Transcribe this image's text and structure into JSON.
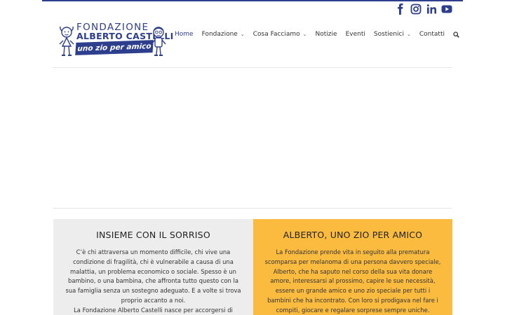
{
  "brand": {
    "line1": "FONDAZIONE",
    "line2": "ALBERTO CASTELLI",
    "tagline": "uno zio per amico",
    "color": "#2d3e8c"
  },
  "social": [
    {
      "icon": "facebook-icon"
    },
    {
      "icon": "instagram-icon"
    },
    {
      "icon": "linkedin-icon"
    },
    {
      "icon": "youtube-icon"
    }
  ],
  "nav": {
    "items": [
      {
        "label": "Home",
        "active": true,
        "dropdown": false
      },
      {
        "label": "Fondazione",
        "active": false,
        "dropdown": true
      },
      {
        "label": "Cosa Facciamo",
        "active": false,
        "dropdown": true
      },
      {
        "label": "Notizie",
        "active": false,
        "dropdown": false
      },
      {
        "label": "Eventi",
        "active": false,
        "dropdown": false
      },
      {
        "label": "Sostienici",
        "active": false,
        "dropdown": true
      },
      {
        "label": "Contatti",
        "active": false,
        "dropdown": false
      }
    ],
    "search_icon": "search-icon"
  },
  "panels": {
    "left": {
      "title": "INSIEME CON IL SORRISO",
      "text1": "C’è chi attraversa un momento difficile, chi vive una condizione di fragilità, chi è vulnerabile a causa di una malattia, un problema economico o sociale. Spesso è un bambino, o una bambina, che affronta tutto questo con la sua famiglia senza un sostegno adeguato. E a volte si trova proprio accanto a noi.",
      "text2": "La Fondazione Alberto Castelli nasce per accorgersi di quella",
      "bg": "#ededed"
    },
    "right": {
      "title": "ALBERTO, UNO ZIO PER AMICO",
      "text1": "La Fondazione prende vita in seguito alla prematura scomparsa per melanoma di una persona davvero speciale, Alberto, che ha saputo nel corso della sua vita donare amore, interessarsi al prossimo, capire le sue necessità, essere un grande amico e uno zio speciale per tutti i bambini che ha incontrato. Con loro si prodigava nel fare i compiti, giocare e regalare sorprese sempre uniche.",
      "bg": "#fbbb3f"
    }
  }
}
